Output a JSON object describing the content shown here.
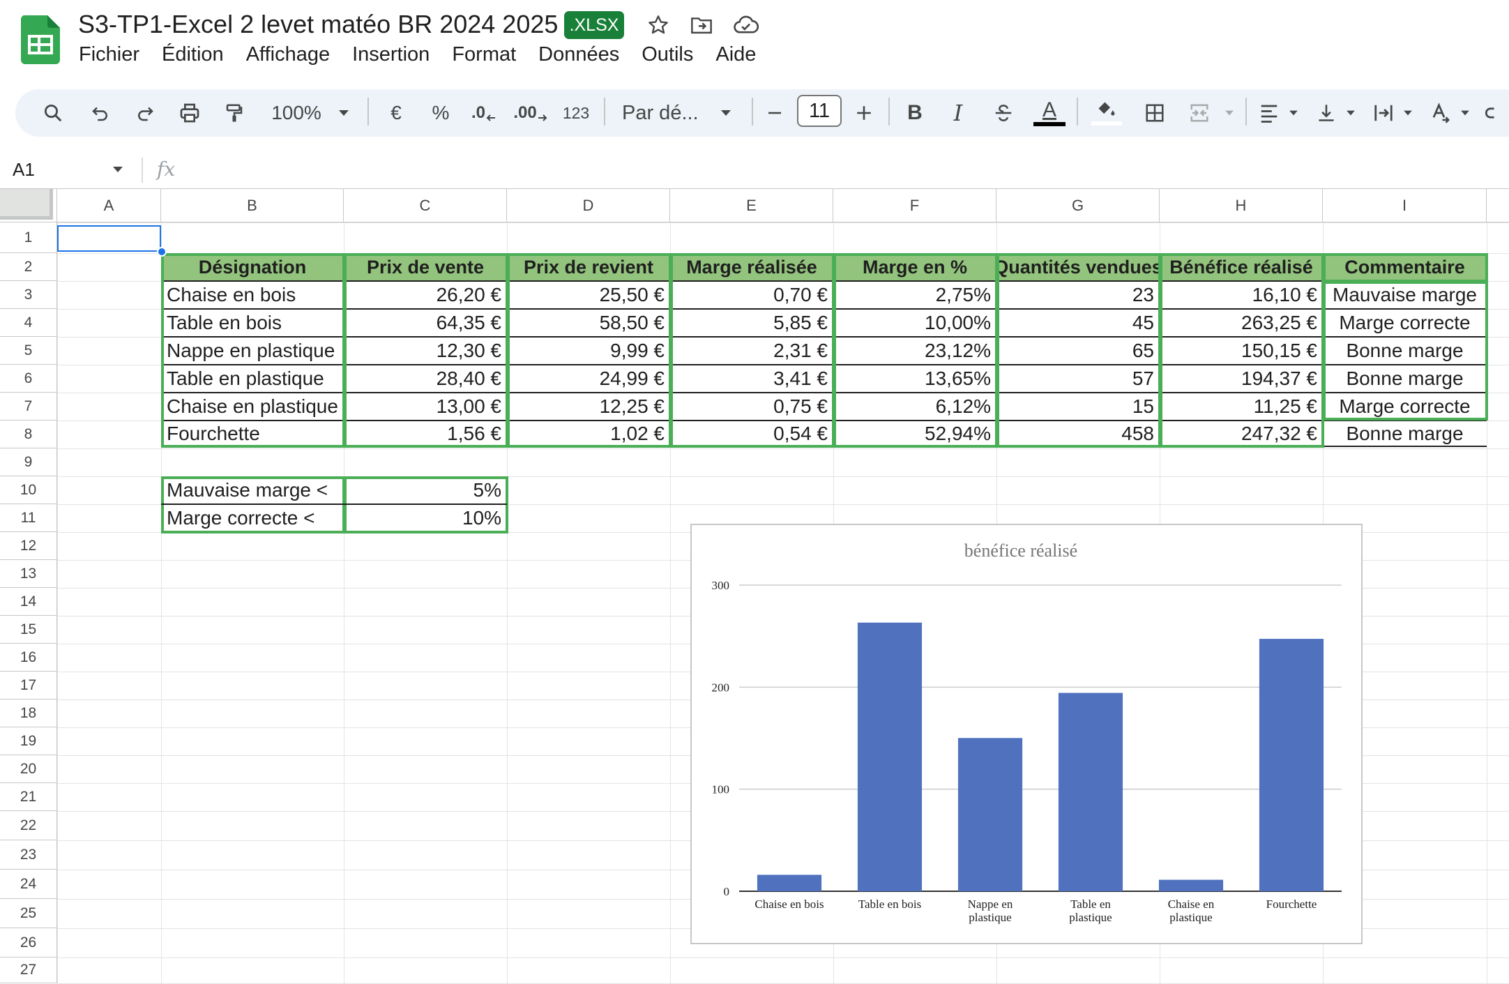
{
  "app": {
    "title": "S3-TP1-Excel 2  levet matéo BR 2024 2025",
    "file_badge": ".XLSX",
    "menu": [
      "Fichier",
      "Édition",
      "Affichage",
      "Insertion",
      "Format",
      "Données",
      "Outils",
      "Aide"
    ]
  },
  "toolbar": {
    "zoom": "100%",
    "currency": "€",
    "percent": "%",
    "decrease_decimals": ".0",
    "increase_decimals": ".00",
    "number_format": "123",
    "font_name": "Par dé...",
    "font_size": "11",
    "bold": "B",
    "italic": "I",
    "text_color": "A"
  },
  "formula_bar": {
    "cell_ref": "A1",
    "fx_label": "fx"
  },
  "columns": [
    "A",
    "B",
    "C",
    "D",
    "E",
    "F",
    "G",
    "H",
    "I"
  ],
  "rows": [
    "1",
    "2",
    "3",
    "4",
    "5",
    "6",
    "7",
    "8",
    "9",
    "10",
    "11",
    "12",
    "13",
    "14",
    "15",
    "16",
    "17",
    "18",
    "19",
    "20",
    "21",
    "22",
    "23",
    "24",
    "25",
    "26",
    "27"
  ],
  "table": {
    "headers": [
      "Désignation",
      "Prix de vente",
      "Prix de revient",
      "Marge réalisée",
      "Marge en %",
      "Quantités vendues",
      "Bénéfice réalisé",
      "Commentaire"
    ],
    "rows": [
      [
        "Chaise en bois",
        "26,20 €",
        "25,50 €",
        "0,70 €",
        "2,75%",
        "23",
        "16,10 €",
        "Mauvaise marge"
      ],
      [
        "Table en bois",
        "64,35 €",
        "58,50 €",
        "5,85 €",
        "10,00%",
        "45",
        "263,25 €",
        "Marge correcte"
      ],
      [
        "Nappe en plastique",
        "12,30 €",
        "9,99 €",
        "2,31 €",
        "23,12%",
        "65",
        "150,15 €",
        "Bonne marge"
      ],
      [
        "Table en plastique",
        "28,40 €",
        "24,99 €",
        "3,41 €",
        "13,65%",
        "57",
        "194,37 €",
        "Bonne marge"
      ],
      [
        "Chaise en plastique",
        "13,00 €",
        "12,25 €",
        "0,75 €",
        "6,12%",
        "15",
        "11,25 €",
        "Marge correcte"
      ],
      [
        "Fourchette",
        "1,56 €",
        "1,02 €",
        "0,54 €",
        "52,94%",
        "458",
        "247,32 €",
        "Bonne marge"
      ]
    ]
  },
  "thresholds": [
    {
      "label": "Mauvaise marge <",
      "value": "5%"
    },
    {
      "label": "Marge correcte <",
      "value": "10%"
    }
  ],
  "chart_data": {
    "type": "bar",
    "title": "bénéfice réalisé",
    "categories": [
      [
        "Chaise en bois"
      ],
      [
        "Table en bois"
      ],
      [
        "Nappe en",
        "plastique"
      ],
      [
        "Table en",
        "plastique"
      ],
      [
        "Chaise en",
        "plastique"
      ],
      [
        "Fourchette"
      ]
    ],
    "values": [
      16.1,
      263.25,
      150.15,
      194.37,
      11.25,
      247.32
    ],
    "yticks": [
      0,
      100,
      200,
      300
    ],
    "ylim": [
      0,
      300
    ],
    "bar_color": "#4f71be",
    "grid": true
  },
  "colors": {
    "header_fill": "#93c47d",
    "table_border": "#4aae56",
    "badge": "#188038",
    "selection": "#1a73e8"
  }
}
